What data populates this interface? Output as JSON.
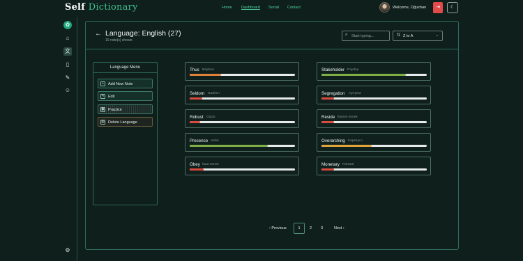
{
  "brand": {
    "part1": "Self",
    "part2": "Dictionary"
  },
  "nav": {
    "links": [
      {
        "label": "Home"
      },
      {
        "label": "Dashboard"
      },
      {
        "label": "Social"
      },
      {
        "label": "Contact"
      }
    ],
    "welcome": "Welcome, Oğuzhan"
  },
  "sidebar": {
    "items": [
      {
        "icon": "logo-icon"
      },
      {
        "icon": "home-icon"
      },
      {
        "icon": "translate-icon"
      },
      {
        "icon": "book-icon"
      },
      {
        "icon": "edit-note-icon"
      },
      {
        "icon": "user-icon"
      },
      {
        "icon": "settings-icon"
      }
    ]
  },
  "header": {
    "title": "Language: English (27)",
    "subtitle": "10 note(s) shown.",
    "search_placeholder": "Start typing...",
    "sort_value": "Z to A"
  },
  "menu": {
    "title": "Language Menu",
    "buttons": [
      {
        "label": "Add New Note"
      },
      {
        "label": "Edit"
      },
      {
        "label": "Practice"
      },
      {
        "label": "Delete Language"
      }
    ]
  },
  "notes": [
    {
      "word": "Thus",
      "translation": "Böylece",
      "progress": 0.3,
      "color": "#e0813a"
    },
    {
      "word": "Seldom",
      "translation": "Nadiren",
      "progress": 0.12,
      "color": "#d94b3e"
    },
    {
      "word": "Robust",
      "translation": "Güçlü",
      "progress": 0.1,
      "color": "#d94b3e"
    },
    {
      "word": "Presence",
      "translation": "Varlık",
      "progress": 0.74,
      "color": "#7fae47"
    },
    {
      "word": "Obey",
      "translation": "İtaat etmek",
      "progress": 0.13,
      "color": "#d94b3e"
    },
    {
      "word": "Stakeholder",
      "translation": "Paydaş",
      "progress": 0.8,
      "color": "#7fae47"
    },
    {
      "word": "Segregation",
      "translation": "Ayrışma",
      "progress": 0.12,
      "color": "#d94b3e"
    },
    {
      "word": "Reside",
      "translation": "İkamet etmek",
      "progress": 0.12,
      "color": "#d94b3e"
    },
    {
      "word": "Overarching",
      "translation": "Kapsayıcı",
      "progress": 0.48,
      "color": "#e0a53a"
    },
    {
      "word": "Monetary",
      "translation": "Parasal",
      "progress": 0.12,
      "color": "#d94b3e"
    }
  ],
  "pagination": {
    "prev": "Previous",
    "next": "Next",
    "pages": [
      "1",
      "2",
      "3"
    ],
    "current": "1"
  }
}
